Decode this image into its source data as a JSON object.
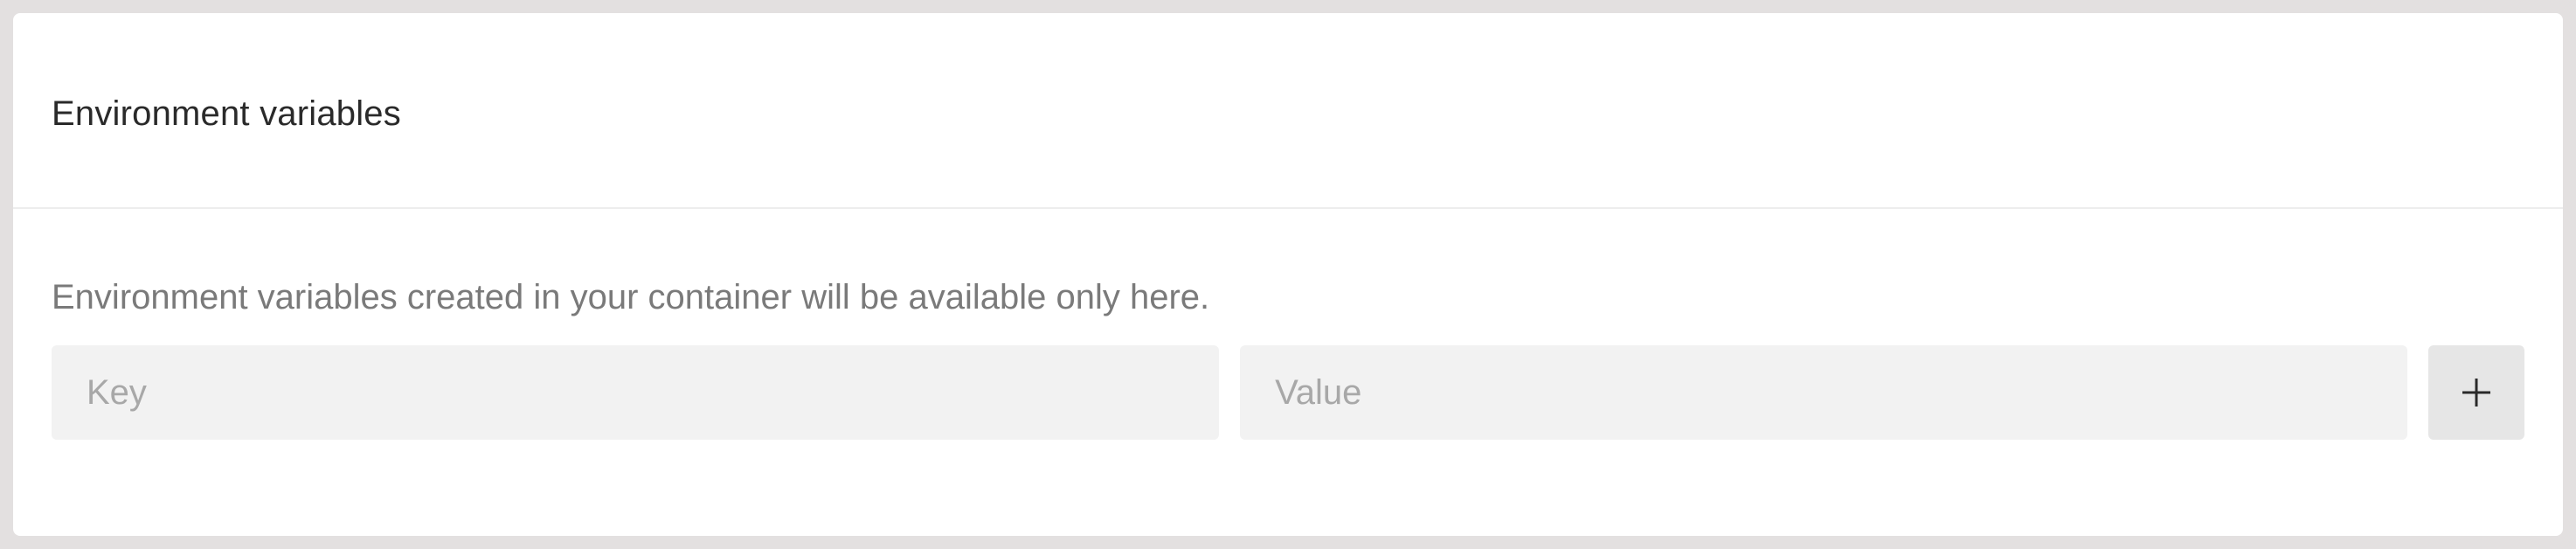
{
  "section": {
    "title": "Environment variables",
    "description": "Environment variables created in your container will be available only here."
  },
  "form": {
    "key_placeholder": "Key",
    "key_value": "",
    "value_placeholder": "Value",
    "value_value": "",
    "add_icon": "plus-icon"
  },
  "colors": {
    "page_background": "#e3e0e0",
    "panel_background": "#ffffff",
    "input_background": "#f2f2f2",
    "button_background": "#e6e6e6",
    "title_text": "#2a2a2a",
    "description_text": "#7a7a7a",
    "placeholder_text": "#a8a8a8"
  }
}
